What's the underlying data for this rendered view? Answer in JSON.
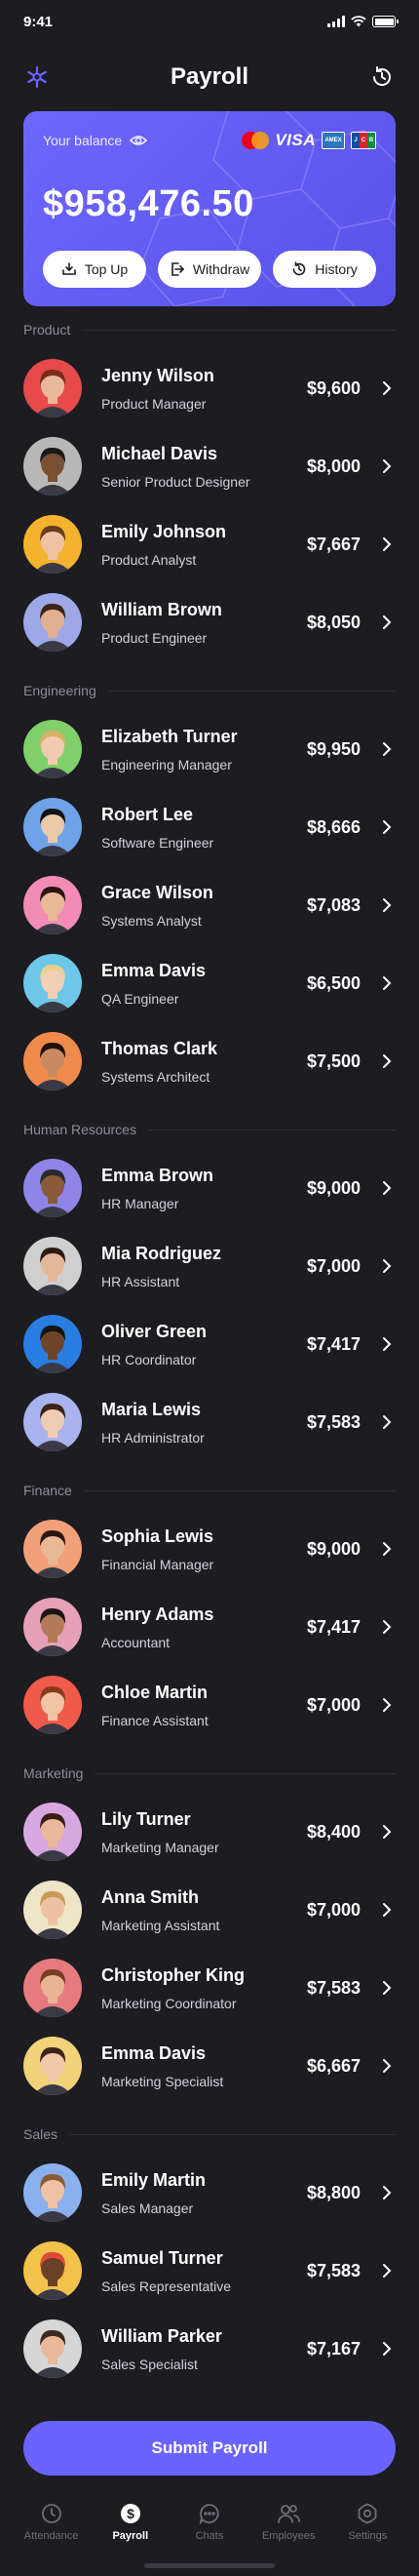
{
  "status": {
    "time": "9:41"
  },
  "header": {
    "title": "Payroll"
  },
  "balance": {
    "label": "Your balance",
    "amount": "$958,476.50",
    "card_brands": {
      "visa": "VISA",
      "amex": "AMEX",
      "jcb": [
        "J",
        "C",
        "B"
      ]
    },
    "actions": [
      {
        "label": "Top Up"
      },
      {
        "label": "Withdraw"
      },
      {
        "label": "History"
      }
    ]
  },
  "sections": [
    {
      "title": "Product",
      "employees": [
        {
          "name": "Jenny Wilson",
          "role": "Product Manager",
          "salary": "$9,600",
          "bg": "#e64a4a",
          "skin": "#e8b89a",
          "hair": "#7a2a1a"
        },
        {
          "name": "Michael Davis",
          "role": "Senior Product Designer",
          "salary": "$8,000",
          "bg": "#b8b8b8",
          "skin": "#7a4f32",
          "hair": "#1a1a1a"
        },
        {
          "name": "Emily Johnson",
          "role": "Product Analyst",
          "salary": "$7,667",
          "bg": "#f4b32e",
          "skin": "#eec3a4",
          "hair": "#6b3b1f"
        },
        {
          "name": "William Brown",
          "role": "Product Engineer",
          "salary": "$8,050",
          "bg": "#9ea8e8",
          "skin": "#e2b090",
          "hair": "#3a2416"
        }
      ]
    },
    {
      "title": "Engineering",
      "employees": [
        {
          "name": "Elizabeth Turner",
          "role": "Engineering Manager",
          "salary": "$9,950",
          "bg": "#7fcf6a",
          "skin": "#f0cbb0",
          "hair": "#d9b066"
        },
        {
          "name": "Robert Lee",
          "role": "Software Engineer",
          "salary": "$8,666",
          "bg": "#6fa3e8",
          "skin": "#eacaa8",
          "hair": "#111111"
        },
        {
          "name": "Grace Wilson",
          "role": "Systems Analyst",
          "salary": "$7,083",
          "bg": "#f28cb6",
          "skin": "#e9b896",
          "hair": "#2a1610"
        },
        {
          "name": "Emma Davis",
          "role": "QA Engineer",
          "salary": "$6,500",
          "bg": "#6cc7e8",
          "skin": "#f2d0b6",
          "hair": "#e9cf8f"
        },
        {
          "name": "Thomas Clark",
          "role": "Systems Architect",
          "salary": "$7,500",
          "bg": "#f08a4a",
          "skin": "#c98a62",
          "hair": "#1e120c"
        }
      ]
    },
    {
      "title": "Human Resources",
      "employees": [
        {
          "name": "Emma Brown",
          "role": "HR Manager",
          "salary": "$9,000",
          "bg": "#8e85e8",
          "skin": "#8a5a3a",
          "hair": "#2a2a2a"
        },
        {
          "name": "Mia Rodriguez",
          "role": "HR Assistant",
          "salary": "$7,000",
          "bg": "#cfcfcf",
          "skin": "#e6b698",
          "hair": "#2b1a12"
        },
        {
          "name": "Oliver Green",
          "role": "HR Coordinator",
          "salary": "$7,417",
          "bg": "#2a7de0",
          "skin": "#6e4428",
          "hair": "#141414"
        },
        {
          "name": "Maria Lewis",
          "role": "HR Administrator",
          "salary": "$7,583",
          "bg": "#a9b3ee",
          "skin": "#f0ccb2",
          "hair": "#3b2416"
        }
      ]
    },
    {
      "title": "Finance",
      "employees": [
        {
          "name": "Sophia Lewis",
          "role": "Financial Manager",
          "salary": "$9,000",
          "bg": "#f2a07a",
          "skin": "#e8b896",
          "hair": "#2a1810"
        },
        {
          "name": "Henry Adams",
          "role": "Accountant",
          "salary": "$7,417",
          "bg": "#e6a0b8",
          "skin": "#b27a56",
          "hair": "#1c1410"
        },
        {
          "name": "Chloe Martin",
          "role": "Finance Assistant",
          "salary": "$7,000",
          "bg": "#f05a4a",
          "skin": "#f0c4a4",
          "hair": "#8a3a1c"
        }
      ]
    },
    {
      "title": "Marketing",
      "employees": [
        {
          "name": "Lily Turner",
          "role": "Marketing Manager",
          "salary": "$8,400",
          "bg": "#d8a6e0",
          "skin": "#eab89a",
          "hair": "#3a1e12"
        },
        {
          "name": "Anna Smith",
          "role": "Marketing Assistant",
          "salary": "$7,000",
          "bg": "#eee4c8",
          "skin": "#edc2a2",
          "hair": "#c79a5a"
        },
        {
          "name": "Christopher King",
          "role": "Marketing Coordinator",
          "salary": "$7,583",
          "bg": "#e67a80",
          "skin": "#e8b494",
          "hair": "#7a3e22"
        },
        {
          "name": "Emma Davis",
          "role": "Marketing Specialist",
          "salary": "$6,667",
          "bg": "#f2d27a",
          "skin": "#f0c8aa",
          "hair": "#3a2418"
        }
      ]
    },
    {
      "title": "Sales",
      "employees": [
        {
          "name": "Emily Martin",
          "role": "Sales Manager",
          "salary": "$8,800",
          "bg": "#8ab0ee",
          "skin": "#eec2a2",
          "hair": "#8a5a36"
        },
        {
          "name": "Samuel Turner",
          "role": "Sales Representative",
          "salary": "$7,583",
          "bg": "#f2c24a",
          "skin": "#6a4026",
          "hair": "#e04a3a"
        },
        {
          "name": "William Parker",
          "role": "Sales Specialist",
          "salary": "$7,167",
          "bg": "#d6d6d6",
          "skin": "#e8b898",
          "hair": "#3a2a20"
        }
      ]
    }
  ],
  "submit": {
    "label": "Submit Payroll"
  },
  "tabs": [
    {
      "label": "Attendance",
      "icon": "clock-icon",
      "active": false
    },
    {
      "label": "Payroll",
      "icon": "dollar-icon",
      "active": true
    },
    {
      "label": "Chats",
      "icon": "chat-icon",
      "active": false
    },
    {
      "label": "Employees",
      "icon": "users-icon",
      "active": false
    },
    {
      "label": "Settings",
      "icon": "gear-icon",
      "active": false
    }
  ],
  "colors": {
    "accent": "#6b63ff",
    "background": "#1c1c21",
    "card": "#6e66ff"
  }
}
